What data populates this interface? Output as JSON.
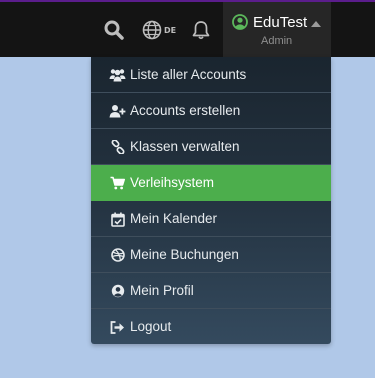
{
  "topbar": {
    "search_icon": "search-icon",
    "language": {
      "icon": "globe-icon",
      "code": "DE"
    },
    "notifications_icon": "bell-icon",
    "user": {
      "name": "EduTest",
      "role": "Admin",
      "avatar_icon": "user-circle-icon"
    }
  },
  "menu": {
    "items": [
      {
        "label": "Liste aller Accounts",
        "icon": "users-icon"
      },
      {
        "label": "Accounts erstellen",
        "icon": "user-plus-icon"
      },
      {
        "label": "Klassen verwalten",
        "icon": "link-icon"
      },
      {
        "label": "Verleihsystem",
        "icon": "cart-icon",
        "active": true
      },
      {
        "label": "Mein Kalender",
        "icon": "calendar-check-icon"
      },
      {
        "label": "Meine Buchungen",
        "icon": "dribbble-icon"
      },
      {
        "label": "Mein Profil",
        "icon": "user-circle-icon"
      },
      {
        "label": "Logout",
        "icon": "sign-out-icon"
      }
    ]
  },
  "colors": {
    "topbar_bg": "#141414",
    "accent_top": "#5b1d8c",
    "active_item": "#4cae4c",
    "page_bg": "#b0c8e8",
    "avatar_green": "#5cb85c"
  }
}
